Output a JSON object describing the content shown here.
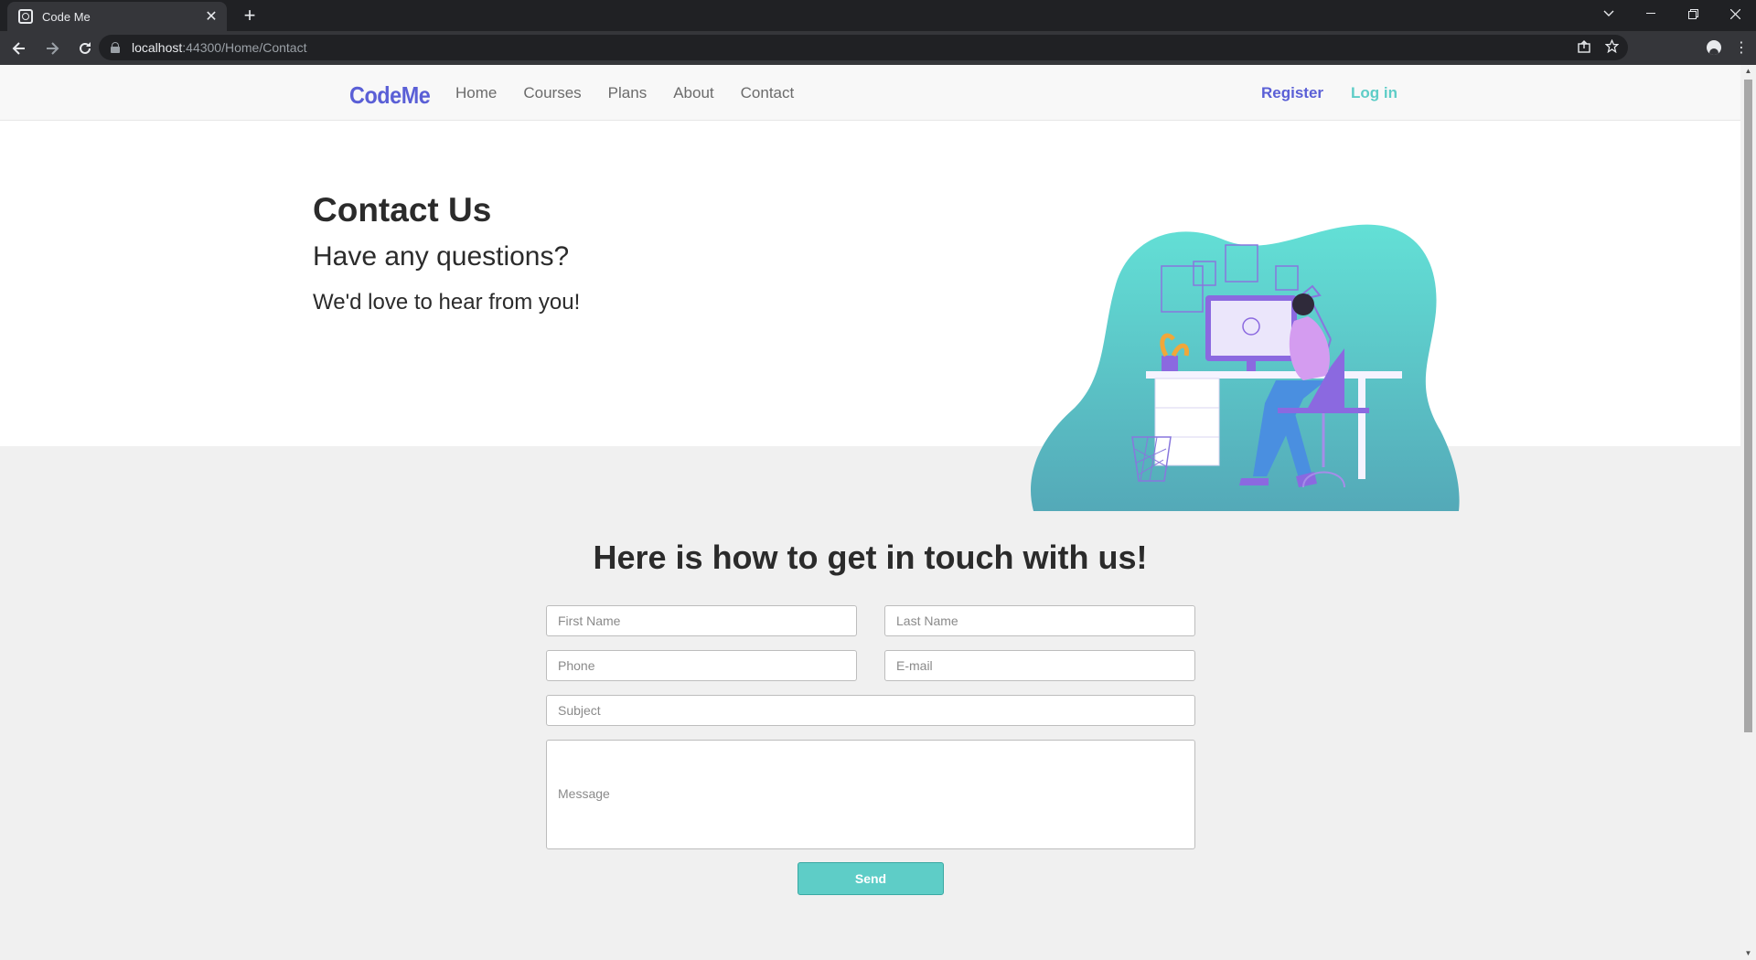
{
  "browser": {
    "tab_title": "Code Me",
    "url_host": "localhost",
    "url_rest": ":44300/Home/Contact",
    "new_tab_glyph": "+",
    "tab_close_glyph": "✕"
  },
  "site": {
    "logo": "CodeMe",
    "nav": [
      "Home",
      "Courses",
      "Plans",
      "About",
      "Contact"
    ],
    "register": "Register",
    "login": "Log in"
  },
  "hero": {
    "title": "Contact Us",
    "subtitle": "Have any questions?",
    "tagline": "We'd love to hear from you!"
  },
  "contact": {
    "heading": "Here is how to get in touch with us!",
    "first_name_placeholder": "First Name",
    "last_name_placeholder": "Last Name",
    "phone_placeholder": "Phone",
    "email_placeholder": "E-mail",
    "subject_placeholder": "Subject",
    "message_placeholder": "Message",
    "send_label": "Send"
  },
  "colors": {
    "brand_purple": "#5a5fd6",
    "brand_teal": "#5ecdc7"
  },
  "icons": [
    "back-arrow-icon",
    "forward-arrow-icon",
    "reload-icon",
    "lock-icon",
    "share-icon",
    "star-icon",
    "profile-icon",
    "kebab-menu-icon",
    "chevron-down-icon",
    "minimize-icon",
    "restore-icon",
    "close-icon"
  ]
}
